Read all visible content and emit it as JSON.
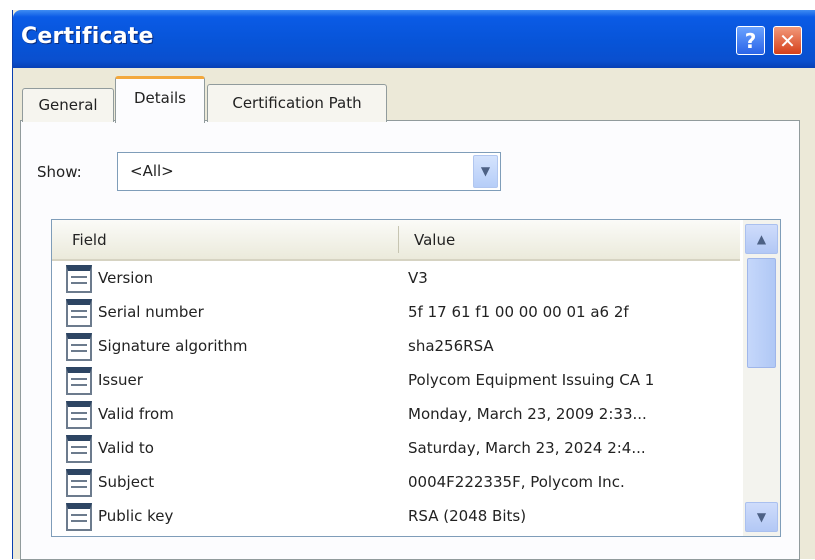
{
  "window": {
    "title": "Certificate",
    "help_label": "?",
    "close_label": "✕"
  },
  "tabs": [
    {
      "label": "General"
    },
    {
      "label": "Details"
    },
    {
      "label": "Certification Path"
    }
  ],
  "show": {
    "label": "Show:",
    "value": "<All>"
  },
  "table": {
    "headers": {
      "field": "Field",
      "value": "Value"
    },
    "rows": [
      {
        "field": "Version",
        "value": "V3"
      },
      {
        "field": "Serial number",
        "value": "5f 17 61 f1 00 00 00 01 a6 2f"
      },
      {
        "field": "Signature algorithm",
        "value": "sha256RSA"
      },
      {
        "field": "Issuer",
        "value": "Polycom Equipment Issuing CA 1"
      },
      {
        "field": "Valid from",
        "value": "Monday, March 23, 2009 2:33..."
      },
      {
        "field": "Valid to",
        "value": "Saturday, March 23, 2024 2:4..."
      },
      {
        "field": "Subject",
        "value": "0004F222335F, Polycom Inc."
      },
      {
        "field": "Public key",
        "value": "RSA (2048 Bits)"
      }
    ]
  },
  "icons": {
    "row": "certificate-field-icon",
    "dropdown": "chevron-down-icon",
    "scroll_up": "chevron-up-icon",
    "scroll_down": "chevron-down-icon"
  },
  "colors": {
    "titlebar": "#0754d8",
    "active_tab_accent": "#f3a83c",
    "close_button": "#d5401b",
    "dialog_bg": "#ece9d8"
  }
}
